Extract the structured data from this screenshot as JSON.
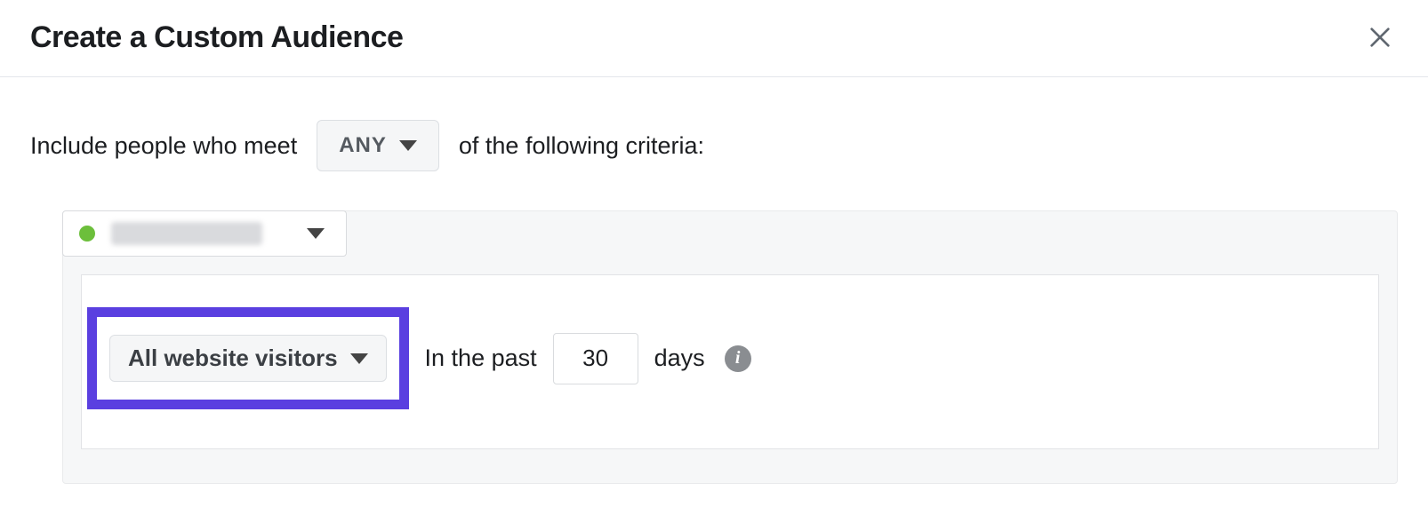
{
  "header": {
    "title": "Create a Custom Audience"
  },
  "criteria": {
    "prefix": "Include people who meet",
    "match_mode": "ANY",
    "suffix": "of the following criteria:"
  },
  "rule": {
    "visitor_type": "All website visitors",
    "in_past_label": "In the past",
    "days_value": "30",
    "days_label": "days"
  }
}
